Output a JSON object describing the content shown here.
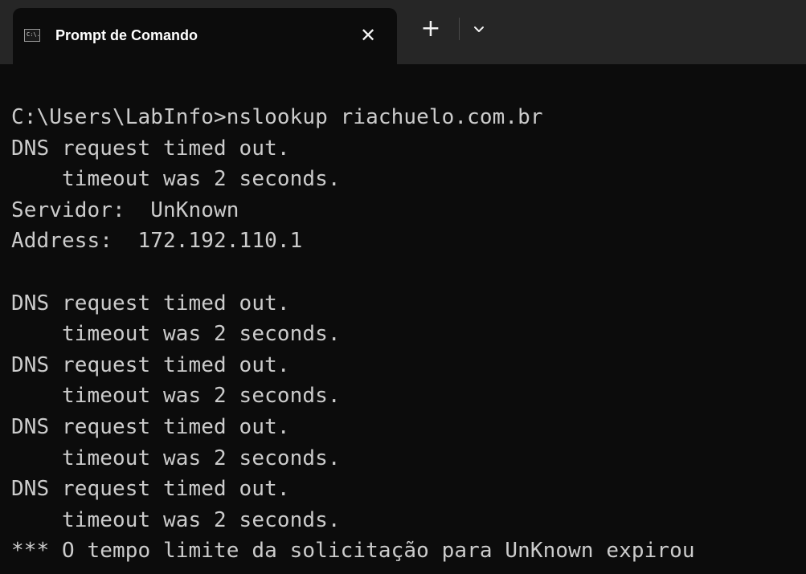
{
  "window": {
    "tab": {
      "icon_name": "cmd-icon",
      "icon_text": "C:\\.",
      "title": "Prompt de Comando",
      "close_glyph": "✕"
    },
    "new_tab_glyph": "+",
    "dropdown_icon": "chevron-down-icon"
  },
  "console": {
    "lines": [
      "C:\\Users\\LabInfo>nslookup riachuelo.com.br",
      "DNS request timed out.",
      "    timeout was 2 seconds.",
      "Servidor:  UnKnown",
      "Address:  172.192.110.1",
      "",
      "DNS request timed out.",
      "    timeout was 2 seconds.",
      "DNS request timed out.",
      "    timeout was 2 seconds.",
      "DNS request timed out.",
      "    timeout was 2 seconds.",
      "DNS request timed out.",
      "    timeout was 2 seconds.",
      "*** O tempo limite da solicitação para UnKnown expirou"
    ]
  },
  "colors": {
    "background": "#0c0c0c",
    "tabbar": "#262626",
    "text": "#cccccc"
  }
}
